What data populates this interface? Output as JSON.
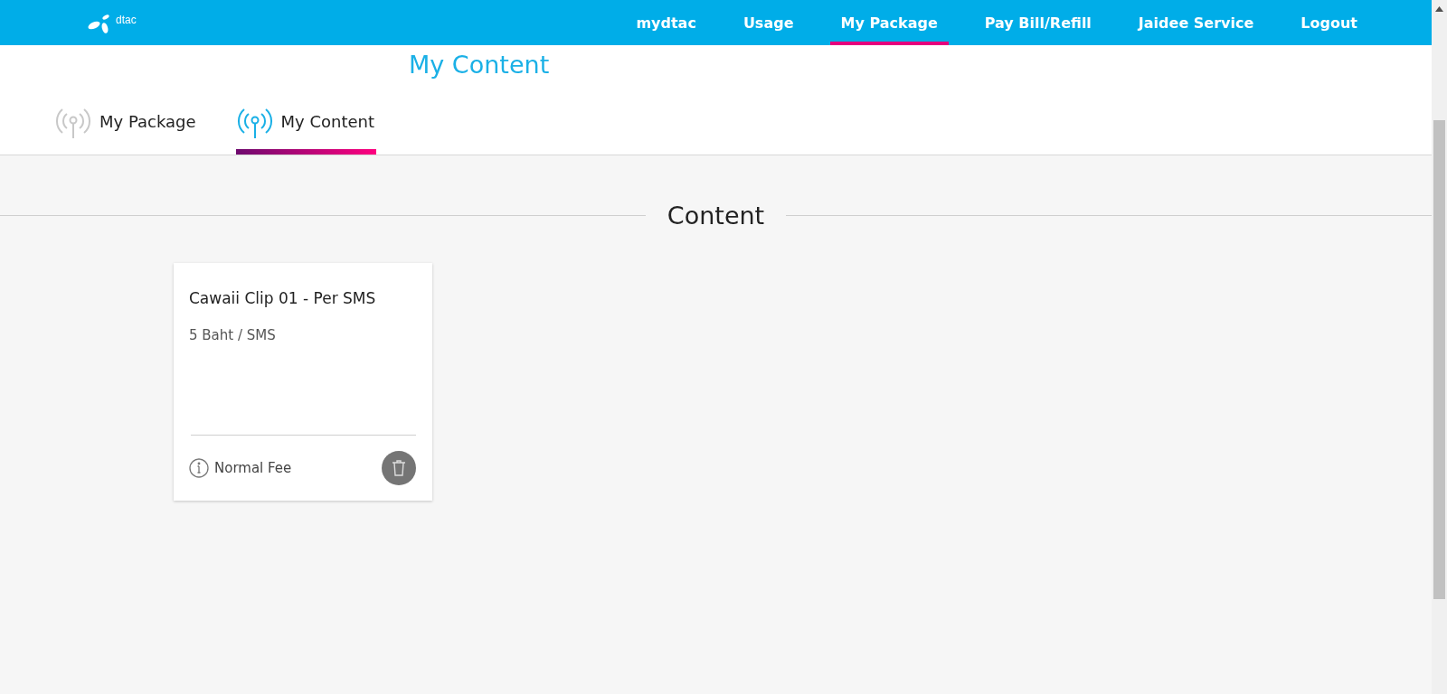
{
  "header": {
    "logo": "dtac",
    "nav": [
      {
        "label": "mydtac",
        "selected": false
      },
      {
        "label": "Usage",
        "selected": false
      },
      {
        "label": "My Package",
        "selected": true
      },
      {
        "label": "Pay Bill/Refill",
        "selected": false
      },
      {
        "label": "Jaidee Service",
        "selected": false
      },
      {
        "label": "Logout",
        "selected": false
      }
    ]
  },
  "page_title": "My Content",
  "tabs": [
    {
      "label": "My Package",
      "selected": false
    },
    {
      "label": "My Content",
      "selected": true
    }
  ],
  "section_title": "Content",
  "cards": [
    {
      "title": "Cawaii Clip 01 - Per SMS",
      "price": "5 Baht / SMS",
      "fee": "Normal Fee"
    }
  ]
}
